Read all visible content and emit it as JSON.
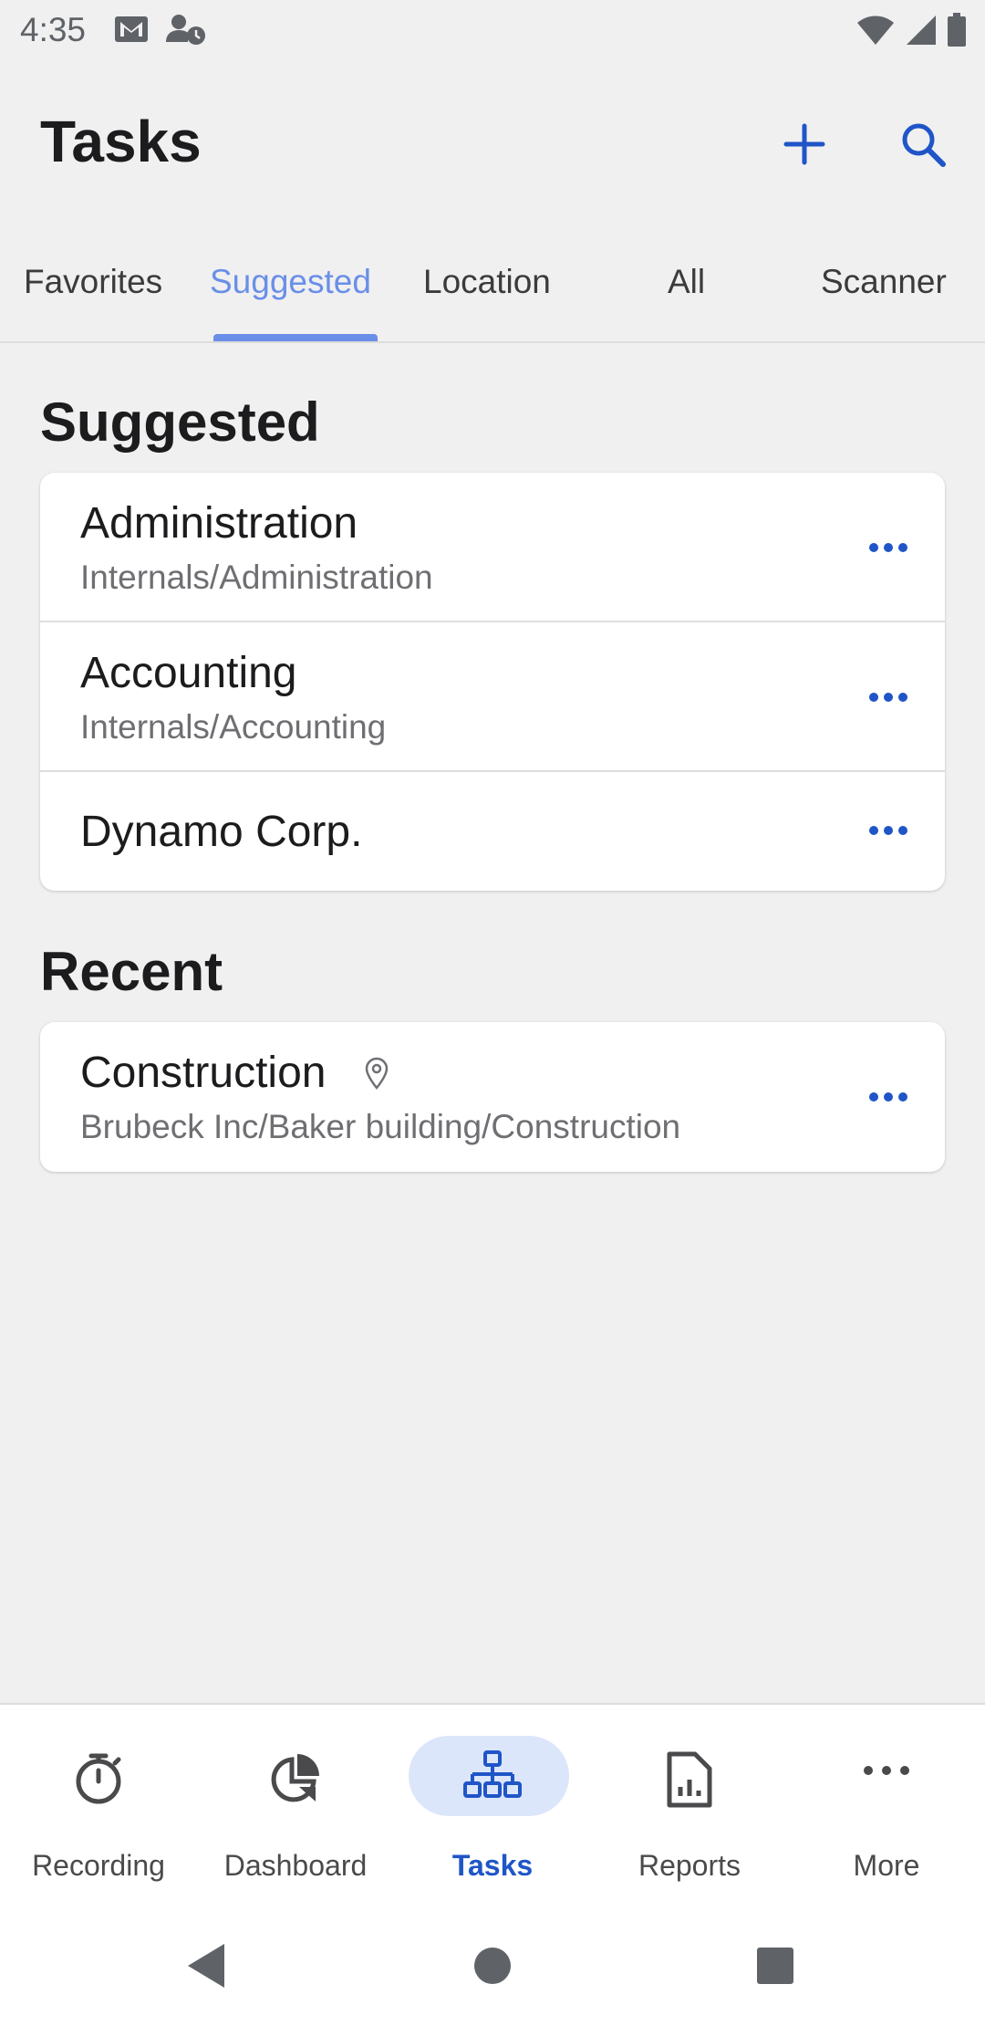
{
  "status": {
    "time": "4:35",
    "left_icons": [
      "gmail-icon",
      "account-clock-icon"
    ],
    "right_icons": [
      "wifi-icon",
      "signal-icon",
      "battery-icon"
    ]
  },
  "appbar": {
    "title": "Tasks",
    "actions": [
      "add-icon",
      "search-icon"
    ]
  },
  "tabs": [
    {
      "label": "Favorites",
      "active": false
    },
    {
      "label": "Suggested",
      "active": true
    },
    {
      "label": "Location",
      "active": false
    },
    {
      "label": "All",
      "active": false
    },
    {
      "label": "Scanner",
      "active": false
    }
  ],
  "suggested": {
    "heading": "Suggested",
    "items": [
      {
        "title": "Administration",
        "subtitle": "Internals/Administration"
      },
      {
        "title": "Accounting",
        "subtitle": "Internals/Accounting"
      },
      {
        "title": "Dynamo Corp.",
        "subtitle": ""
      }
    ]
  },
  "recent": {
    "heading": "Recent",
    "items": [
      {
        "title": "Construction",
        "subtitle": "Brubeck Inc/Baker building/Construction",
        "icon": "location-pin-icon"
      }
    ]
  },
  "bottom_nav": [
    {
      "label": "Recording",
      "icon": "stopwatch-icon",
      "active": false
    },
    {
      "label": "Dashboard",
      "icon": "pie-chart-icon",
      "active": false
    },
    {
      "label": "Tasks",
      "icon": "hierarchy-icon",
      "active": true
    },
    {
      "label": "Reports",
      "icon": "report-icon",
      "active": false
    },
    {
      "label": "More",
      "icon": "more-horizontal-icon",
      "active": false
    }
  ],
  "colors": {
    "accent": "#1f55c7",
    "tab_active": "#6a8fe8",
    "background": "#f0f0f0",
    "nav_pill": "#dce6fa"
  }
}
